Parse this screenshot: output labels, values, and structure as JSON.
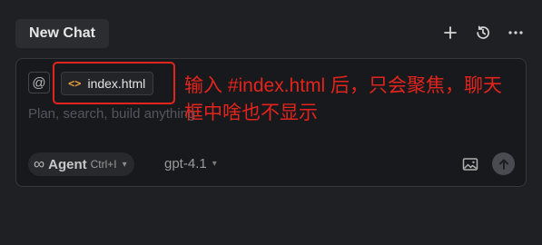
{
  "header": {
    "tab_label": "New Chat",
    "actions": [
      {
        "name": "new-chat",
        "icon": "plus-icon"
      },
      {
        "name": "history",
        "icon": "history-icon"
      },
      {
        "name": "more",
        "icon": "more-icon"
      }
    ]
  },
  "composer": {
    "mention_symbol": "@",
    "context_file": {
      "icon": "code-icon",
      "name": "index.html"
    },
    "placeholder": "Plan, search, build anything",
    "mode": {
      "label": "Agent",
      "shortcut": "Ctrl+I",
      "icon": "infinity-icon"
    },
    "model": "gpt-4.1",
    "image_button_icon": "image-icon",
    "send_button_icon": "arrow-up-icon"
  },
  "annotation": {
    "text": "输入 #index.html 后，只会聚焦，聊天框中啥也不显示",
    "color": "#e3241d"
  }
}
